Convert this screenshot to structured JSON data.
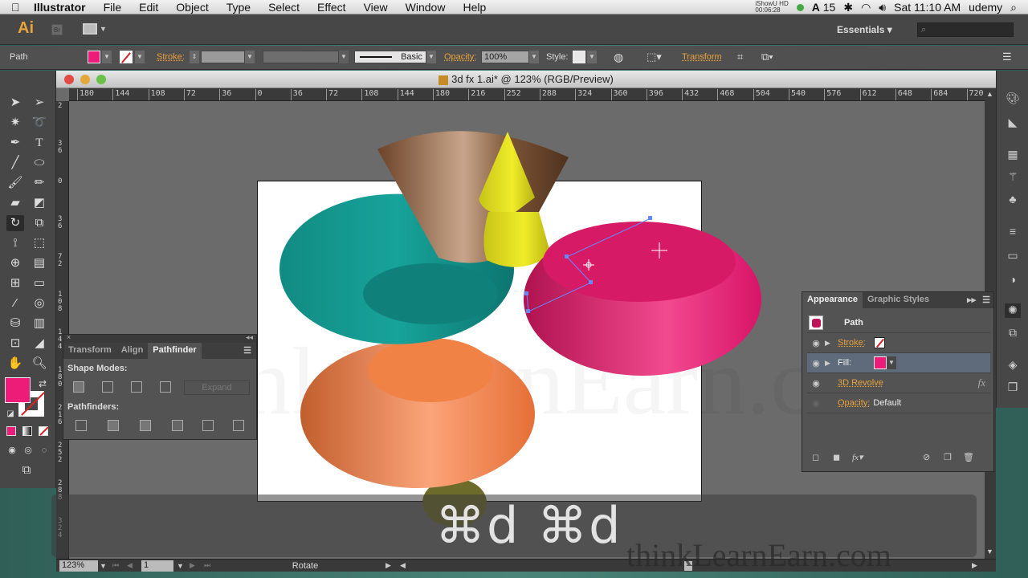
{
  "menubar": {
    "app": "Illustrator",
    "items": [
      "File",
      "Edit",
      "Object",
      "Type",
      "Select",
      "Effect",
      "View",
      "Window",
      "Help"
    ],
    "recorder": "iShowU HD",
    "recorder_time": "00:06:28",
    "adobe_count": "15",
    "clock": "Sat 11:10 AM",
    "user": "udemy"
  },
  "appbar": {
    "logo": "Ai",
    "bridge": "Br",
    "workspace": "Essentials",
    "search_placeholder": ""
  },
  "control": {
    "selection_type": "Path",
    "fill_color": "#ed1c79",
    "stroke_label": "Stroke:",
    "stroke_weight": "",
    "brush": "Basic",
    "opacity_label": "Opacity:",
    "opacity_value": "100%",
    "style_label": "Style:",
    "transform_label": "Transform"
  },
  "document": {
    "title": "3d fx 1.ai* @ 123% (RGB/Preview)",
    "h_ruler": [
      "180",
      "144",
      "108",
      "72",
      "36",
      "0",
      "36",
      "72",
      "108",
      "144",
      "180",
      "216",
      "252",
      "288",
      "324",
      "360",
      "396",
      "432",
      "468",
      "504",
      "540",
      "576",
      "612",
      "648",
      "684",
      "720"
    ],
    "v_ruler": [
      "2",
      "36",
      "0",
      "36",
      "72",
      "108",
      "144",
      "180",
      "216",
      "252",
      "288",
      "324"
    ]
  },
  "status": {
    "zoom": "123%",
    "page": "1",
    "tool": "Rotate"
  },
  "pathfinder_panel": {
    "tabs": [
      "Transform",
      "Align",
      "Pathfinder"
    ],
    "active_tab": "Pathfinder",
    "shape_modes_label": "Shape Modes:",
    "expand_label": "Expand",
    "pathfinders_label": "Pathfinders:"
  },
  "appearance_panel": {
    "tabs": [
      "Appearance",
      "Graphic Styles"
    ],
    "active_tab": "Appearance",
    "object": "Path",
    "rows": [
      {
        "label": "Stroke:",
        "value": "none"
      },
      {
        "label": "Fill:",
        "value": "#ed1c79"
      },
      {
        "label": "3D Revolve",
        "value": "fx"
      },
      {
        "label": "Opacity:",
        "value": "Default"
      }
    ]
  },
  "overlay": {
    "keys": "⌘d ⌘d",
    "watermark": "thinkLearnEarn.com"
  },
  "colors": {
    "accent": "#e8a13c",
    "fill": "#ed1c79",
    "teal": "#13918a",
    "brown": "#6b4328",
    "yellow": "#e4e020",
    "orange": "#f3834a"
  }
}
